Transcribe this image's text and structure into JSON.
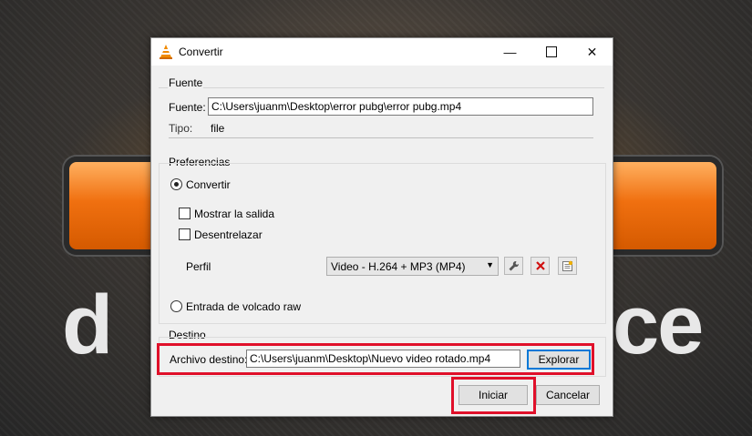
{
  "window": {
    "title": "Convertir"
  },
  "fuente": {
    "group_title": "Fuente",
    "label": "Fuente:",
    "value": "C:\\Users\\juanm\\Desktop\\error pubg\\error pubg.mp4",
    "type_label": "Tipo:",
    "type_value": "file"
  },
  "preferencias": {
    "group_title": "Preferencias",
    "convert_label": "Convertir",
    "show_output_label": "Mostrar la salida",
    "deinterlace_label": "Desentrelazar",
    "profile_label": "Perfil",
    "profile_value": "Video - H.264 + MP3 (MP4)",
    "raw_dump_label": "Entrada de volcado raw"
  },
  "destino": {
    "group_title": "Destino",
    "label": "Archivo destino:",
    "value": "C:\\Users\\juanm\\Desktop\\Nuevo video rotado.mp4",
    "browse_label": "Explorar"
  },
  "actions": {
    "start_label": "Iniciar",
    "cancel_label": "Cancelar"
  },
  "colors": {
    "highlight": "#e0102a",
    "focus": "#0078d7"
  },
  "icons": [
    "vlc-cone-icon",
    "wrench-icon",
    "delete-x-icon",
    "new-profile-icon"
  ]
}
